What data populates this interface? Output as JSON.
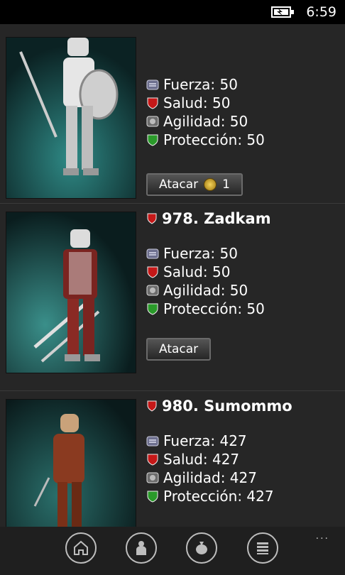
{
  "status": {
    "time": "6:59"
  },
  "cards": [
    {
      "title": "",
      "stats": {
        "fuerza": "Fuerza: 50",
        "salud": "Salud: 50",
        "agilidad": "Agilidad: 50",
        "proteccion": "Protección: 50"
      },
      "button": {
        "label": "Atacar",
        "cost": "1"
      }
    },
    {
      "title": "978. Zadkam",
      "stats": {
        "fuerza": "Fuerza: 50",
        "salud": "Salud: 50",
        "agilidad": "Agilidad: 50",
        "proteccion": "Protección: 50"
      },
      "button": {
        "label": "Atacar"
      }
    },
    {
      "title": "980. Sumommo",
      "stats": {
        "fuerza": "Fuerza: 427",
        "salud": "Salud: 427",
        "agilidad": "Agilidad: 427",
        "proteccion": "Protección: 427"
      }
    }
  ],
  "appbar": {
    "more": "..."
  },
  "icons": {
    "fuerza": "fist-icon",
    "salud": "heart-shield-icon",
    "agilidad": "agility-icon",
    "proteccion": "protection-shield-icon",
    "home": "home-icon",
    "character": "character-icon",
    "bag": "money-bag-icon",
    "menu": "list-menu-icon"
  }
}
